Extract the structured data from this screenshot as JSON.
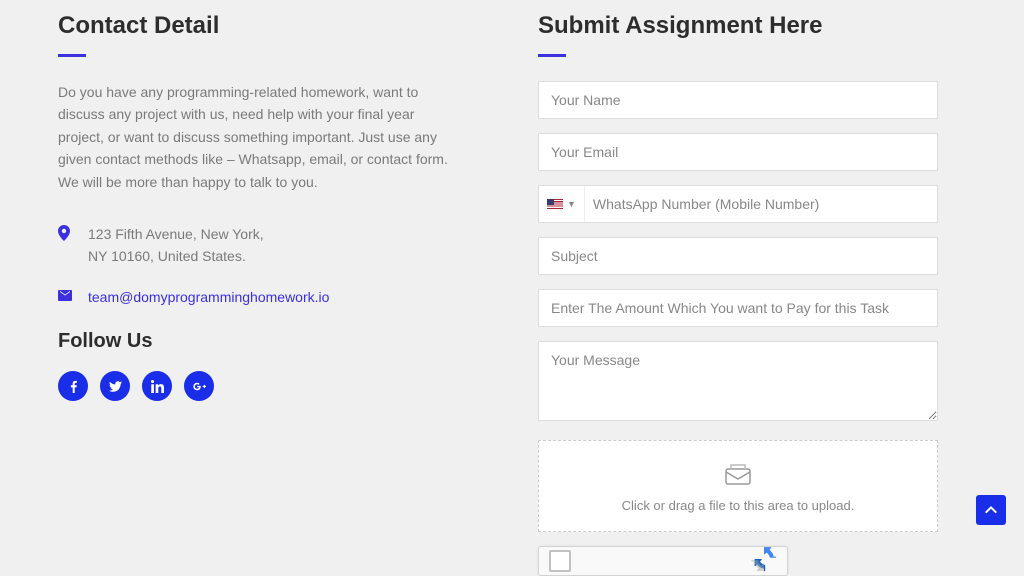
{
  "contact": {
    "title": "Contact Detail",
    "description_line1": "Do you have any programming-related homework, want to discuss any project with us, need help with your final year project, or want to discuss something important. Just use any given contact methods like – Whatsapp, email, or contact form.",
    "description_line2": "We will be more than happy to talk to you.",
    "address_line1": "123 Fifth Avenue, New York,",
    "address_line2": "NY 10160, United States.",
    "email": "team@domyprogramminghomework.io"
  },
  "follow": {
    "title": "Follow Us"
  },
  "form": {
    "title": "Submit Assignment Here",
    "name_placeholder": "Your Name",
    "email_placeholder": "Your Email",
    "phone_placeholder": "WhatsApp Number (Mobile Number)",
    "subject_placeholder": "Subject",
    "amount_placeholder": "Enter The Amount Which You want to Pay for this Task",
    "message_placeholder": "Your Message",
    "upload_text": "Click or drag a file to this area to upload."
  }
}
